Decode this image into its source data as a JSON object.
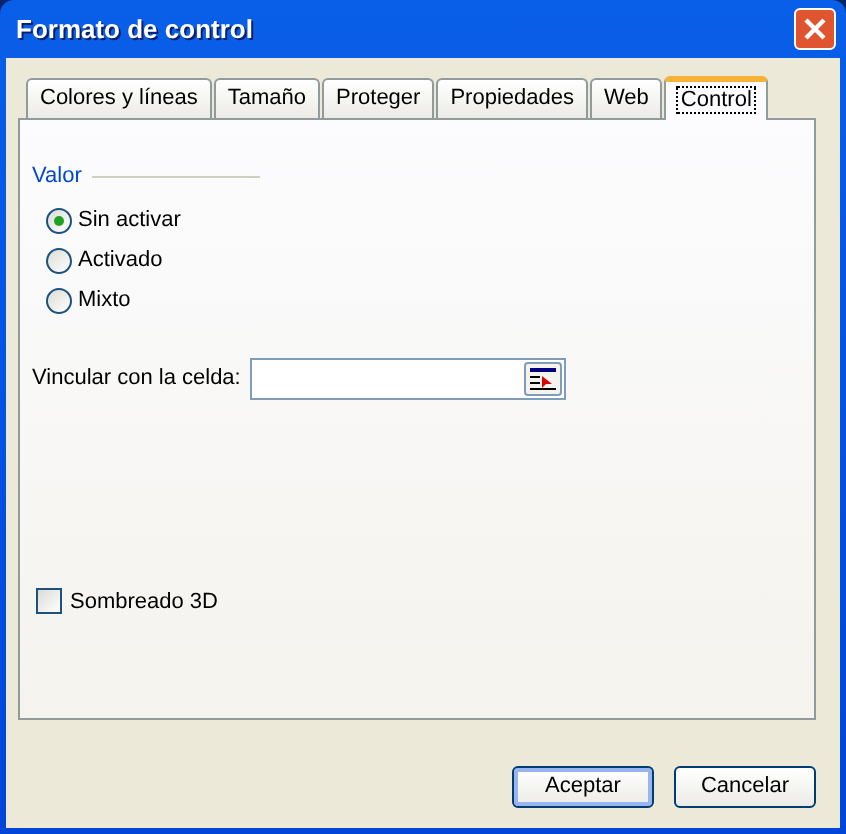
{
  "window": {
    "title": "Formato de control"
  },
  "tabs": [
    {
      "label": "Colores y líneas",
      "selected": false
    },
    {
      "label": "Tamaño",
      "selected": false
    },
    {
      "label": "Proteger",
      "selected": false
    },
    {
      "label": "Propiedades",
      "selected": false
    },
    {
      "label": "Web",
      "selected": false
    },
    {
      "label": "Control",
      "selected": true
    }
  ],
  "value_group": {
    "title": "Valor",
    "options": [
      {
        "label": "Sin activar",
        "selected": true
      },
      {
        "label": "Activado",
        "selected": false
      },
      {
        "label": "Mixto",
        "selected": false
      }
    ]
  },
  "cell_link": {
    "label": "Vincular con la celda:"
  },
  "shading": {
    "label": "Sombreado 3D",
    "checked": false
  },
  "buttons": [
    {
      "label": "Aceptar",
      "default": true
    },
    {
      "label": "Cancelar",
      "default": false
    }
  ]
}
